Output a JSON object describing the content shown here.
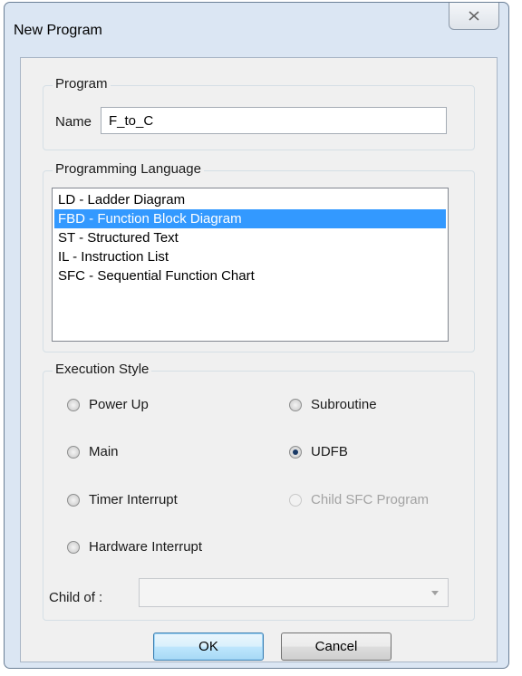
{
  "window": {
    "title": "New Program"
  },
  "program": {
    "group_label": "Program",
    "name_label": "Name",
    "name_value": "F_to_C"
  },
  "language": {
    "group_label": "Programming Language",
    "items": [
      "LD - Ladder Diagram",
      "FBD - Function Block Diagram",
      "ST - Structured Text",
      "IL - Instruction List",
      "SFC - Sequential Function Chart"
    ],
    "selected_index": 1
  },
  "execution": {
    "group_label": "Execution Style",
    "options": {
      "power_up": "Power Up",
      "subroutine": "Subroutine",
      "main": "Main",
      "udfb": "UDFB",
      "timer_interrupt": "Timer Interrupt",
      "child_sfc": "Child SFC Program",
      "hardware_interrupt": "Hardware Interrupt"
    },
    "selected": "UDFB",
    "child_of_label": "Child of :",
    "child_of_value": ""
  },
  "buttons": {
    "ok": "OK",
    "cancel": "Cancel"
  },
  "colors": {
    "selection": "#3399ff",
    "frame": "#dbe6f3"
  }
}
